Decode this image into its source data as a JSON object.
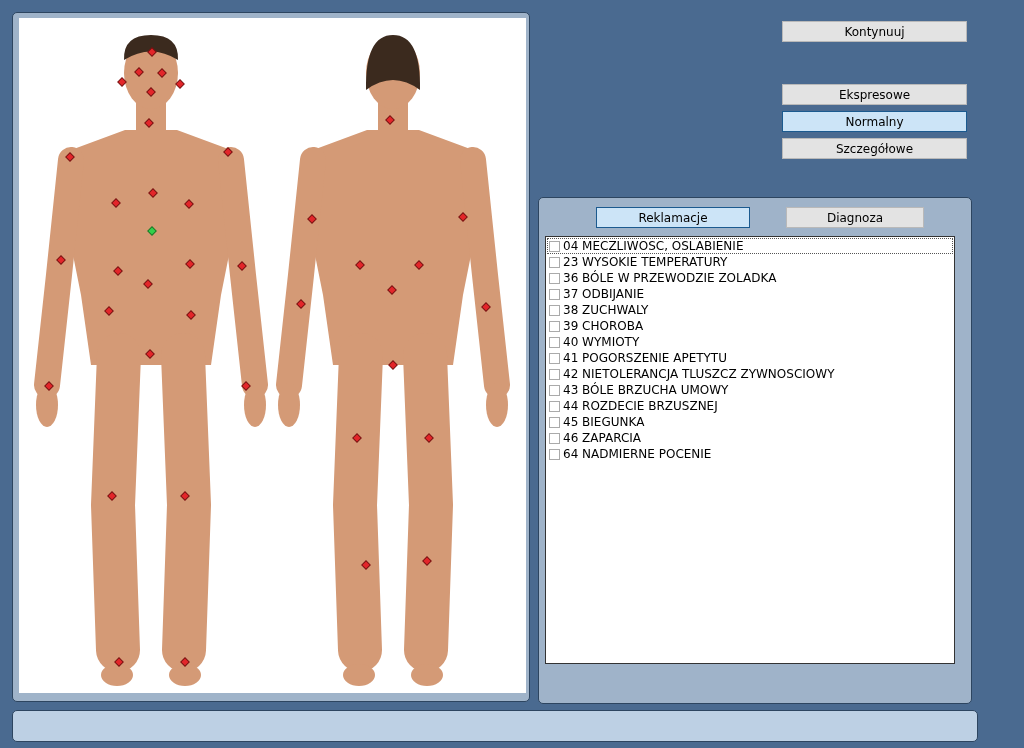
{
  "actions": {
    "continue_button": "Kontynuuj"
  },
  "modes": [
    {
      "label": "Ekspresowe",
      "selected": false
    },
    {
      "label": "Normalny",
      "selected": true
    },
    {
      "label": "Szczegółowe",
      "selected": false
    }
  ],
  "tabs": [
    {
      "label": "Reklamacje",
      "selected": true
    },
    {
      "label": "Diagnoza",
      "selected": false
    }
  ],
  "complaints": [
    {
      "label": "04 MECZLIWOSC, OSLABIENIE",
      "checked": false,
      "focused": true
    },
    {
      "label": "23 WYSOKIE TEMPERATURY",
      "checked": false,
      "focused": false
    },
    {
      "label": "36 BÓLE W PRZEWODZIE ZOLADKA",
      "checked": false,
      "focused": false
    },
    {
      "label": "37 ODBIJANIE",
      "checked": false,
      "focused": false
    },
    {
      "label": "38 ZUCHWALY",
      "checked": false,
      "focused": false
    },
    {
      "label": "39 CHOROBA",
      "checked": false,
      "focused": false
    },
    {
      "label": "40 WYMIOTY",
      "checked": false,
      "focused": false
    },
    {
      "label": "41 POGORSZENIE APETYTU",
      "checked": false,
      "focused": false
    },
    {
      "label": "42 NIETOLERANCJA TLUSZCZ ZYWNOSCIOWY",
      "checked": false,
      "focused": false
    },
    {
      "label": "43 BÓLE BRZUCHA UMOWY",
      "checked": false,
      "focused": false
    },
    {
      "label": "44 ROZDECIE BRZUSZNEJ",
      "checked": false,
      "focused": false
    },
    {
      "label": "45 BIEGUNKA",
      "checked": false,
      "focused": false
    },
    {
      "label": "46 ZAPARCIA",
      "checked": false,
      "focused": false
    },
    {
      "label": "64 NADMIERNE POCENIE",
      "checked": false,
      "focused": false
    }
  ],
  "body_points": [
    {
      "selected": false
    },
    {
      "selected": false
    },
    {
      "selected": false
    },
    {
      "selected": false
    },
    {
      "selected": false
    },
    {
      "selected": false
    },
    {
      "selected": false
    },
    {
      "selected": false
    },
    {
      "selected": false
    },
    {
      "selected": false
    },
    {
      "selected": false
    },
    {
      "selected": false
    },
    {
      "selected": true
    },
    {
      "selected": false
    },
    {
      "selected": false
    },
    {
      "selected": false
    },
    {
      "selected": false
    },
    {
      "selected": false
    },
    {
      "selected": false
    },
    {
      "selected": false
    },
    {
      "selected": false
    },
    {
      "selected": false
    },
    {
      "selected": false
    },
    {
      "selected": false
    },
    {
      "selected": false
    },
    {
      "selected": false
    },
    {
      "selected": false
    },
    {
      "selected": false
    },
    {
      "selected": false
    },
    {
      "selected": false
    },
    {
      "selected": false
    },
    {
      "selected": false
    },
    {
      "selected": false
    },
    {
      "selected": false
    },
    {
      "selected": false
    },
    {
      "selected": false
    },
    {
      "selected": false
    },
    {
      "selected": false
    },
    {
      "selected": false
    },
    {
      "selected": false
    }
  ]
}
